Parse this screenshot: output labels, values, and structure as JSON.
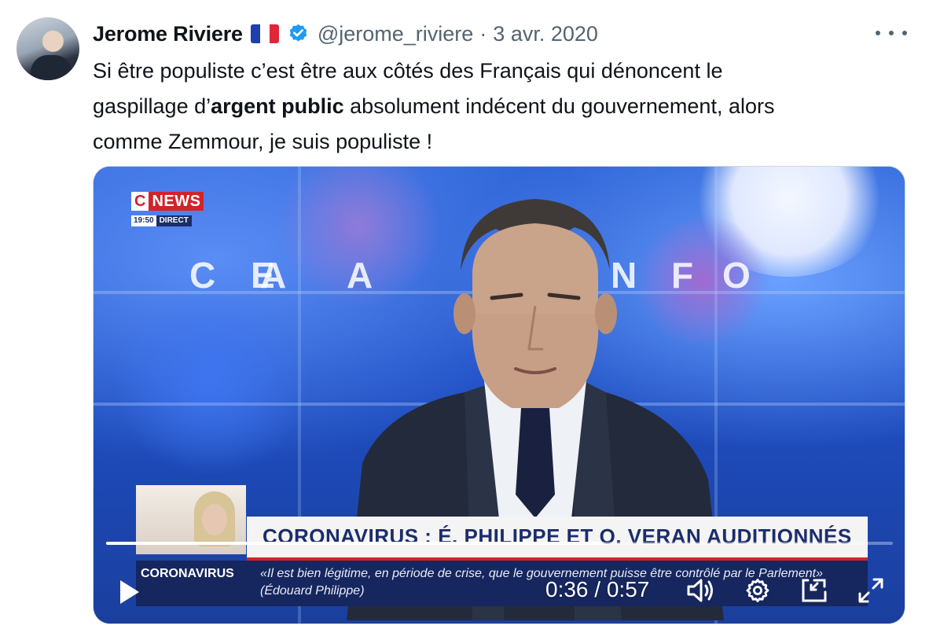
{
  "tweet": {
    "author_name": "Jerome Riviere",
    "handle": "@jerome_riviere",
    "separator": "·",
    "date": "3 avr. 2020",
    "text_line1": "Si être populiste c’est être aux côtés des Français qui dénoncent le",
    "text_line2_a": "gaspillage d’",
    "text_line2_bold": "argent public",
    "text_line2_b": " absolument indécent du gouvernement, alors",
    "text_line3": "comme Zemmour, je suis populiste !"
  },
  "icons": {
    "flag": "france-flag-icon",
    "verified": "verified-badge-icon",
    "more": "more-options-icon",
    "play": "play-icon",
    "volume": "volume-icon",
    "settings": "gear-icon",
    "pip": "picture-in-picture-icon",
    "fullscreen": "fullscreen-icon"
  },
  "video": {
    "channel_logo_c": "C",
    "channel_logo_news": "NEWS",
    "channel_time": "19:50",
    "channel_live": "DIRECT",
    "studio_letters": [
      "A",
      "C",
      "E",
      "A",
      "N",
      "F",
      "O"
    ],
    "banner_text": "CORONAVIRUS : É. PHILIPPE ET O. VERAN AUDITIONNÉS",
    "ticker_label": "CORONAVIRUS",
    "ticker_text": "«Il est bien légitime, en période de crise, que le gouvernement puisse être contrôlé par le Parlement» (Édouard Philippe)",
    "current_time": "0:36",
    "time_separator": " / ",
    "duration": "0:57",
    "progress_fraction": 0.632
  },
  "colors": {
    "brand_blue": "#1d9bf0",
    "text_primary": "#0f1419",
    "text_secondary": "#536471",
    "cnews_red": "#d2232a",
    "cnews_navy": "#1b2d6b"
  }
}
